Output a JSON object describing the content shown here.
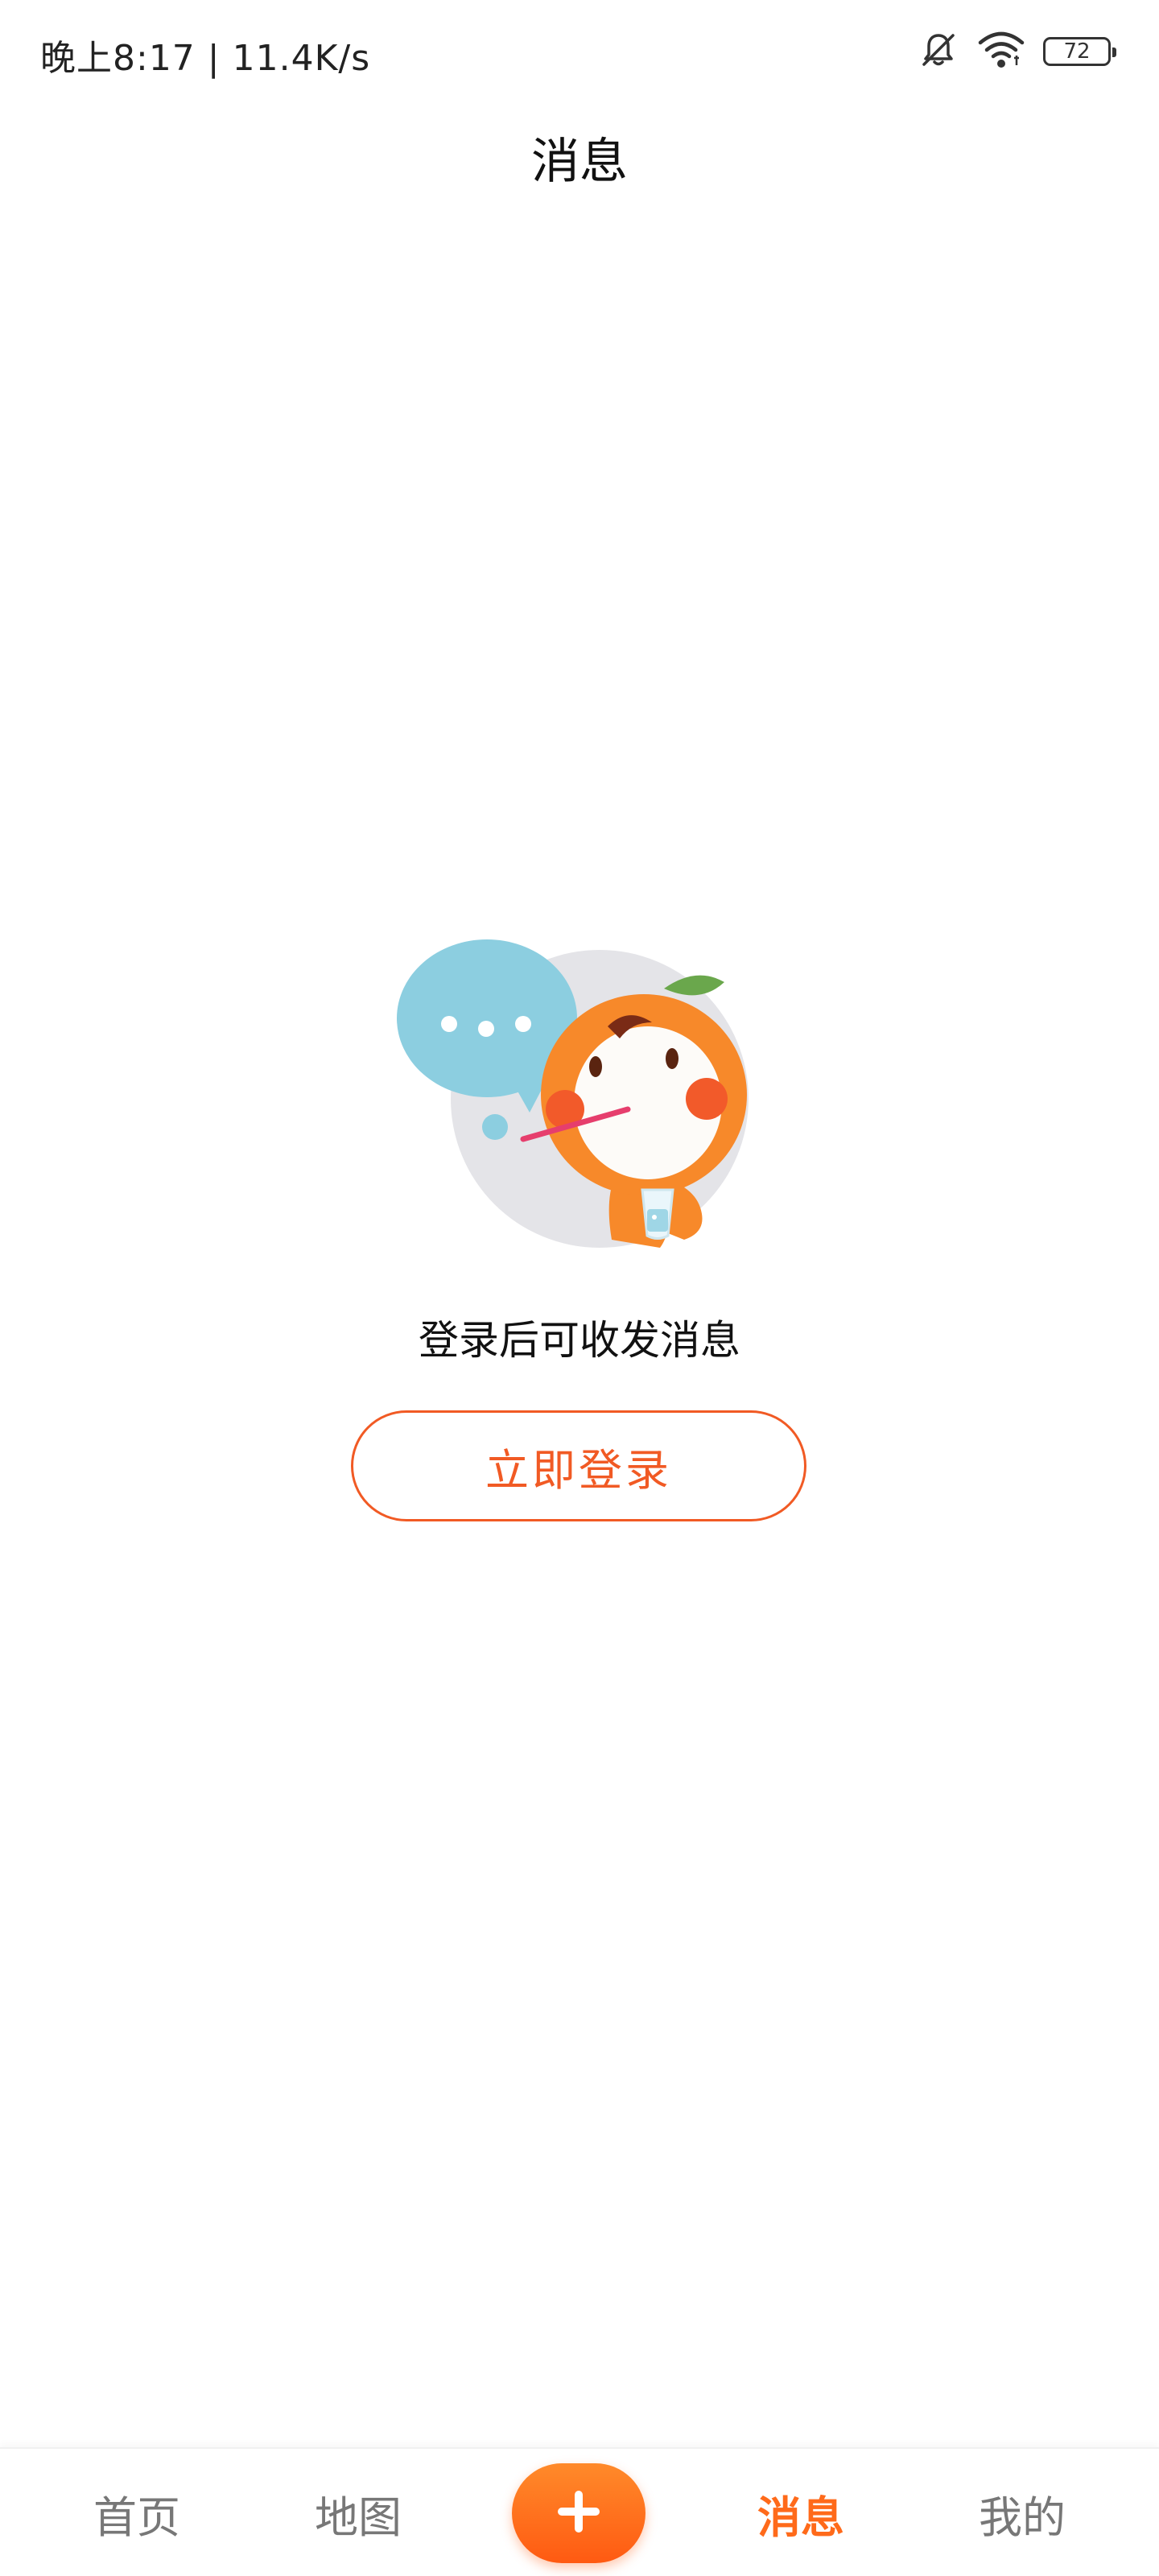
{
  "status_bar": {
    "time_speed": "晚上8:17 | 11.4K/s",
    "battery": "72",
    "icons": [
      "bell-muted-icon",
      "wifi-icon",
      "battery-icon"
    ]
  },
  "header": {
    "title": "消息"
  },
  "empty_state": {
    "illustration": "orange-mascot-chat-illustration",
    "message": "登录后可收发消息",
    "login_button": "立即登录"
  },
  "bottom_nav": {
    "items": [
      {
        "label": "首页",
        "active": false
      },
      {
        "label": "地图",
        "active": false
      },
      {
        "label": "",
        "icon": "plus-icon",
        "active": false
      },
      {
        "label": "消息",
        "active": true
      },
      {
        "label": "我的",
        "active": false
      }
    ]
  },
  "colors": {
    "accent": "#ff6a1a",
    "button_border": "#f15a24",
    "inactive_nav": "#777777"
  }
}
